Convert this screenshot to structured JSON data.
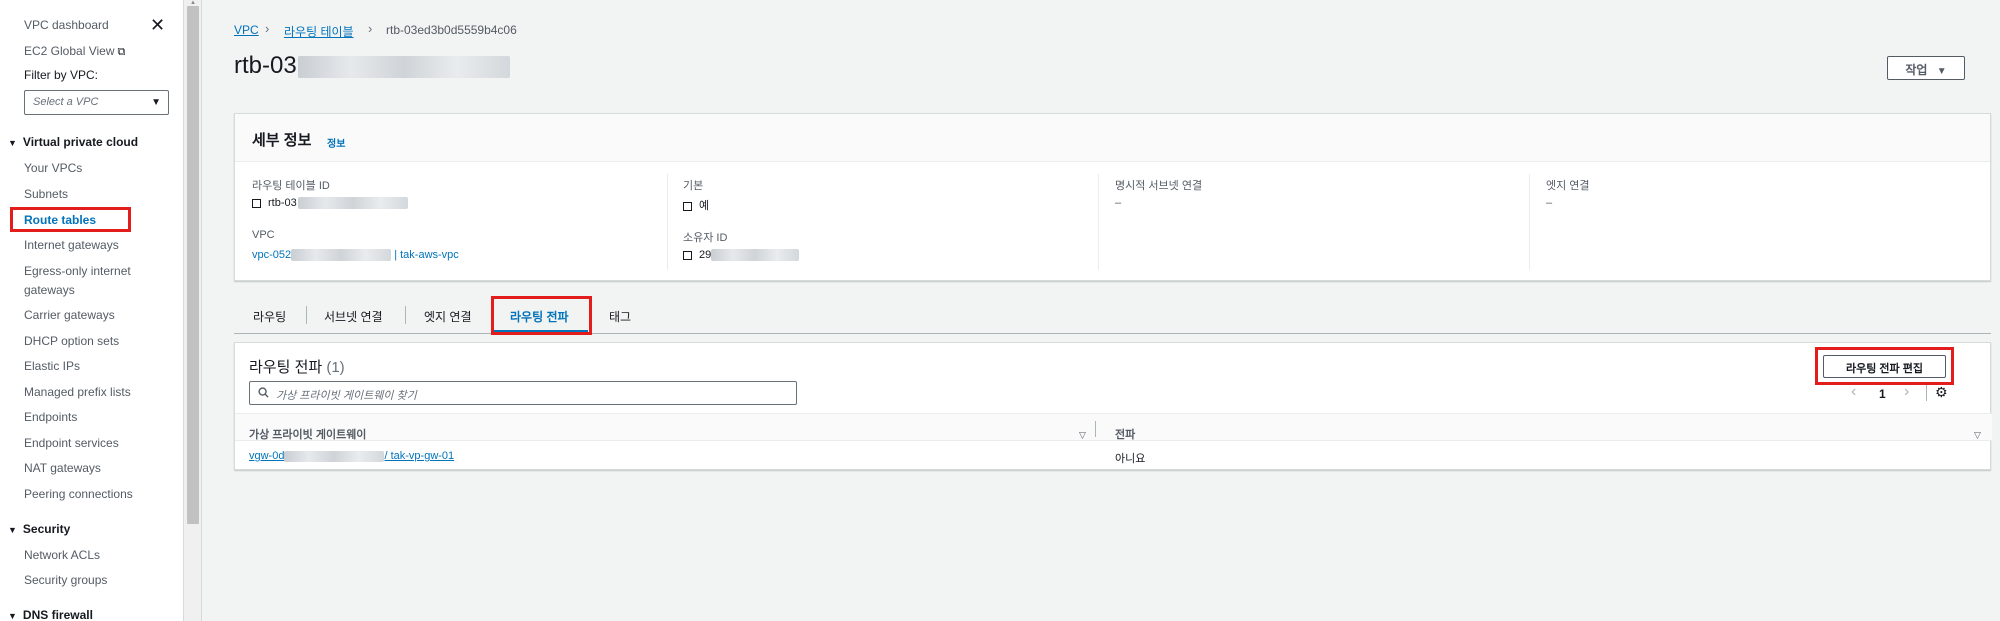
{
  "sidebar": {
    "top_links": [
      "VPC dashboard",
      "EC2 Global View"
    ],
    "filter_label": "Filter by VPC:",
    "vpc_select_placeholder": "Select a VPC",
    "sections": [
      {
        "title": "Virtual private cloud",
        "items": [
          "Your VPCs",
          "Subnets",
          "Route tables",
          "Internet gateways",
          "Egress-only internet",
          "gateways",
          "Carrier gateways",
          "DHCP option sets",
          "Elastic IPs",
          "Managed prefix lists",
          "Endpoints",
          "Endpoint services",
          "NAT gateways",
          "Peering connections"
        ]
      },
      {
        "title": "Security",
        "items": [
          "Network ACLs",
          "Security groups"
        ]
      },
      {
        "title": "DNS firewall",
        "items": []
      }
    ]
  },
  "breadcrumb": [
    "VPC",
    "라우팅 테이블",
    "rtb-03ed3b0d5559b4c06"
  ],
  "page": {
    "title_prefix": "rtb-03",
    "action_button": "작업"
  },
  "details": {
    "heading": "세부 정보",
    "info_link": "정보",
    "fields": {
      "rt_id_label": "라우팅 테이블 ID",
      "rt_id_value": "rtb-03",
      "main_label": "기본",
      "main_value": "예",
      "explicit_label": "명시적 서브넷 연결",
      "explicit_value": "–",
      "edge_label": "엣지 연결",
      "edge_value": "–",
      "vpc_label": "VPC",
      "vpc_prefix": "vpc-052",
      "vpc_name": "| tak-aws-vpc",
      "owner_label": "소유자 ID",
      "owner_prefix": "29"
    }
  },
  "tabs": [
    "라우팅",
    "서브넷 연결",
    "엣지 연결",
    "라우팅 전파",
    "태그"
  ],
  "propagation": {
    "heading": "라우팅 전파",
    "count": "(1)",
    "edit_button": "라우팅 전파 편집",
    "search_placeholder": "가상 프라이빗 게이트웨이 찾기",
    "page_number": "1",
    "columns": [
      "가상 프라이빗 게이트웨이",
      "전파"
    ],
    "rows": [
      {
        "gateway_prefix": "vgw-0d",
        "gateway_suffix": "/ tak-vp-gw-01",
        "propagation": "아니요"
      }
    ]
  },
  "colors": {
    "accent": "#0073bb",
    "highlight": "#e31c1c"
  }
}
